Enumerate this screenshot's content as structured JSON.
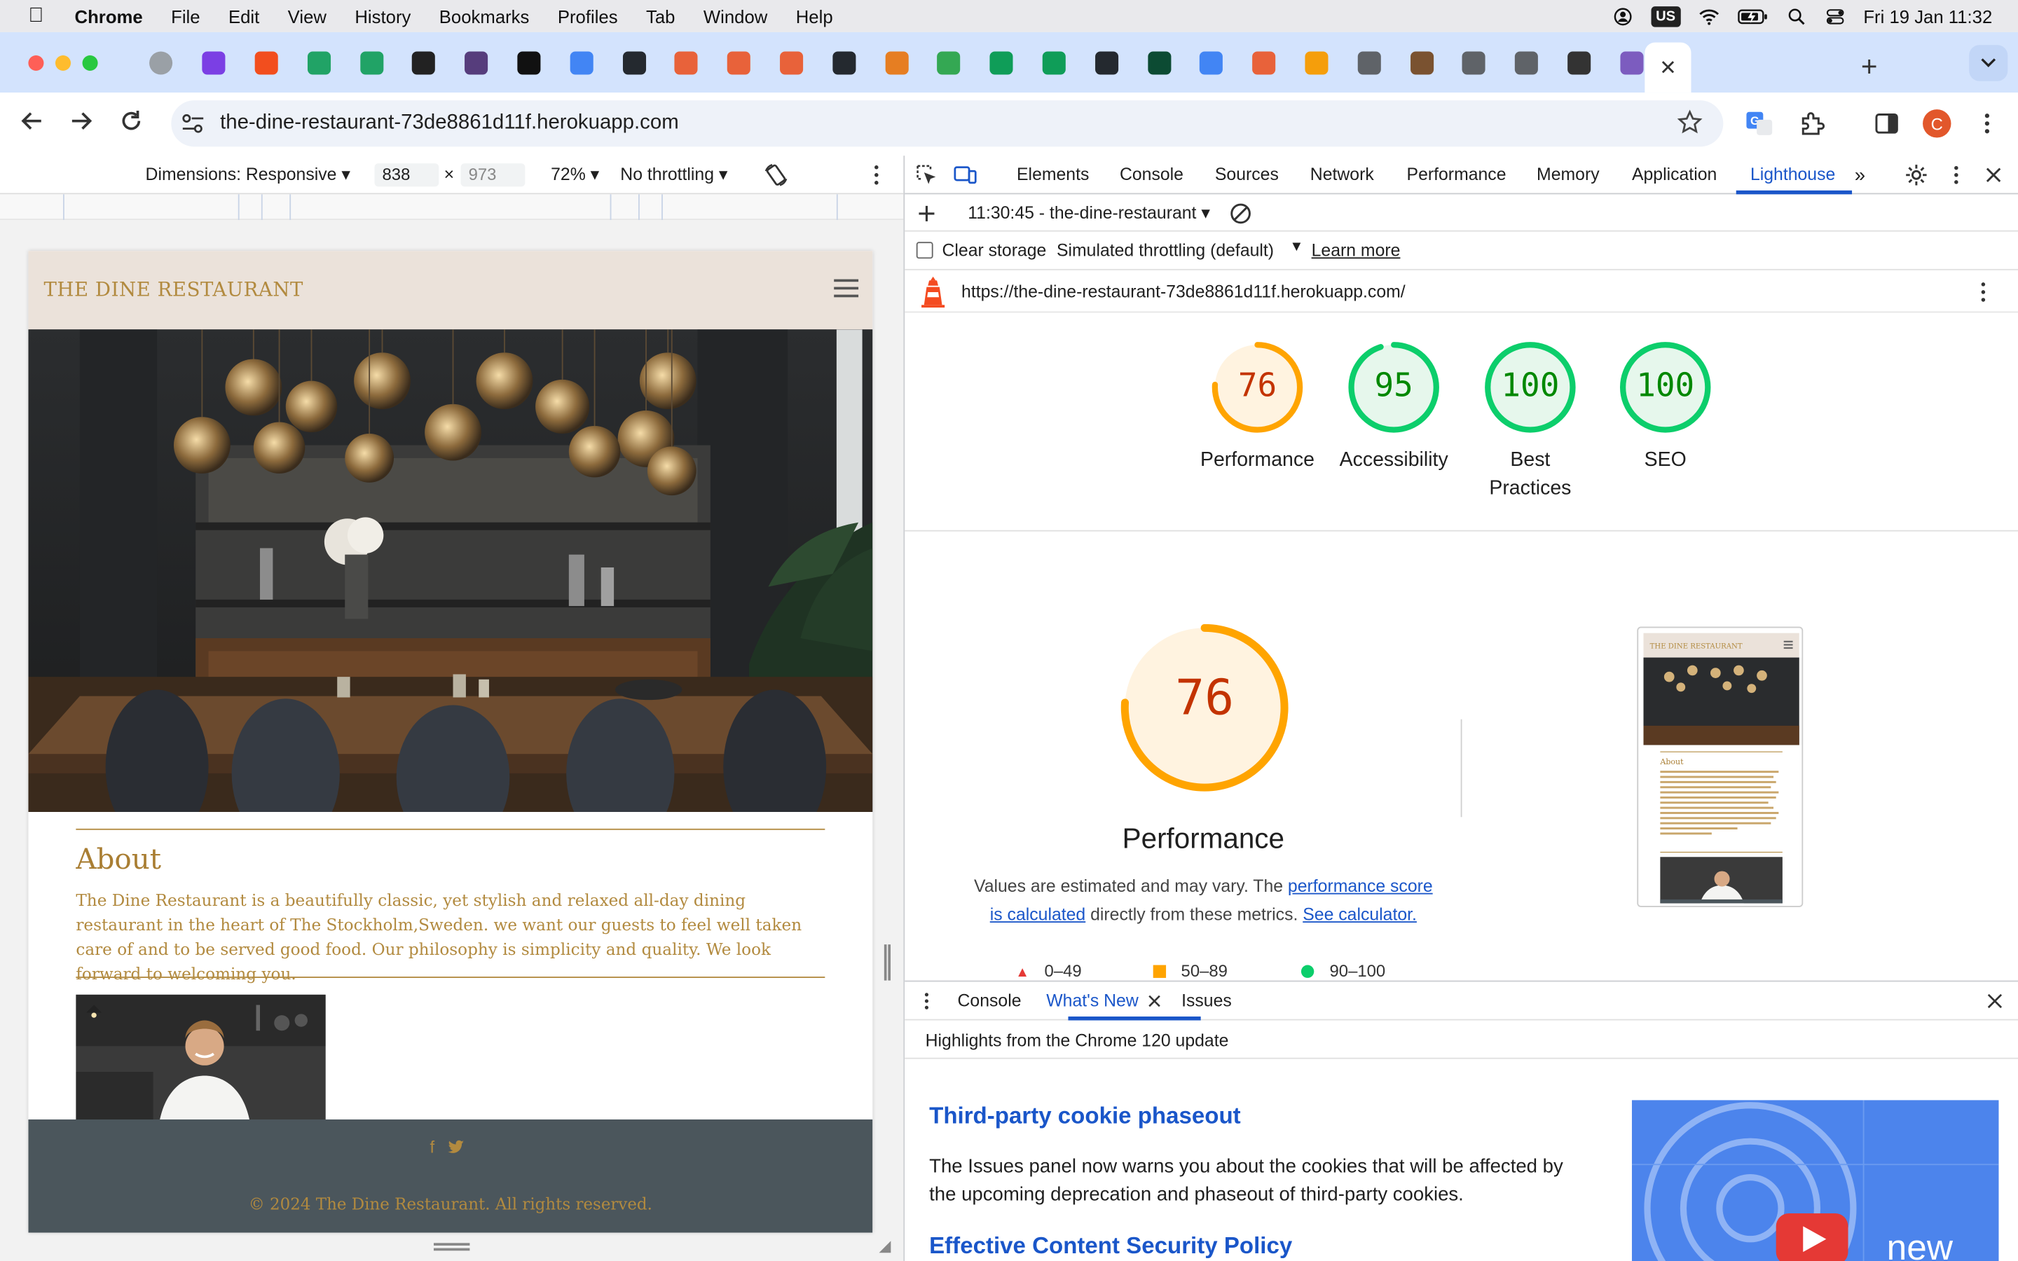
{
  "menubar": {
    "app": "Chrome",
    "items": [
      "File",
      "Edit",
      "View",
      "History",
      "Bookmarks",
      "Profiles",
      "Tab",
      "Window",
      "Help"
    ],
    "input_source": "US",
    "datetime": "Fri 19 Jan  11:32"
  },
  "tabs": {
    "favicon_colors": [
      "#9aa0a6",
      "#7b3fe4",
      "#f24e1e",
      "#21a366",
      "#21a366",
      "#222222",
      "#563d7c",
      "#111111",
      "#4285f4",
      "#24292f",
      "#e8623a",
      "#e8623a",
      "#e8623a",
      "#24292f",
      "#e67e22",
      "#34a853",
      "#0f9d58",
      "#0f9d58",
      "#24292f",
      "#0c4b33",
      "#4285f4",
      "#e8623a",
      "#f59e0b",
      "#5f6368",
      "#7a5230",
      "#5f6368",
      "#5f6368",
      "#333333",
      "#7c5cbf"
    ],
    "active_close": "✕",
    "new_tab": "+"
  },
  "toolbar": {
    "url": "the-dine-restaurant-73de8861d11f.herokuapp.com",
    "profile_initial": "C"
  },
  "device_toolbar": {
    "dimensions_label": "Dimensions: Responsive",
    "width": "838",
    "height": "973",
    "times": "×",
    "zoom": "72%",
    "throttling": "No throttling"
  },
  "site": {
    "brand": "THE DINE RESTAURANT",
    "about_title": "About",
    "about_text": "The Dine Restaurant is a beautifully classic, yet stylish and relaxed all-day dining restaurant in the heart of The Stockholm,Sweden. we want our guests to feel well taken care of and to be served good food. Our philosophy is simplicity and quality. We look forward to welcoming you.",
    "footer_copy": "© 2024 The Dine Restaurant. All rights reserved."
  },
  "devtools": {
    "tabs": [
      "Elements",
      "Console",
      "Sources",
      "Network",
      "Performance",
      "Memory",
      "Application",
      "Lighthouse"
    ],
    "active_tab": "Lighthouse",
    "more": "»",
    "report_selector": "11:30:45 - the-dine-restaurant",
    "clear_storage": "Clear storage",
    "throttling": "Simulated throttling (default)",
    "learn_more": "Learn more",
    "report_url": "https://the-dine-restaurant-73de8861d11f.herokuapp.com/"
  },
  "lighthouse": {
    "scores": [
      {
        "label": "Performance",
        "value": 76,
        "color": "#c33300",
        "ring": "#ffa400",
        "bg": "#fff3e0"
      },
      {
        "label": "Accessibility",
        "value": 95,
        "color": "#008800",
        "ring": "#0cce6b",
        "bg": "#e6f7ec"
      },
      {
        "label": "Best Practices",
        "value": 100,
        "color": "#008800",
        "ring": "#0cce6b",
        "bg": "#e6f7ec"
      },
      {
        "label": "SEO",
        "value": 100,
        "color": "#008800",
        "ring": "#0cce6b",
        "bg": "#e6f7ec"
      }
    ],
    "perf_score": "76",
    "perf_title": "Performance",
    "note_pre": "Values are estimated and may vary. The ",
    "note_link1": "performance score is calculated",
    "note_mid": " directly from these metrics. ",
    "note_link2": "See calculator.",
    "legend": [
      "0–49",
      "50–89",
      "90–100"
    ]
  },
  "drawer": {
    "tabs": [
      "Console",
      "What's New",
      "Issues"
    ],
    "active_tab": "What's New",
    "highlights": "Highlights from the Chrome 120 update",
    "h1": "Third-party cookie phaseout",
    "p1": "The Issues panel now warns you about the cookies that will be affected by the upcoming deprecation and phaseout of third-party cookies.",
    "h2": "Effective Content Security Policy",
    "video_word": "new"
  }
}
